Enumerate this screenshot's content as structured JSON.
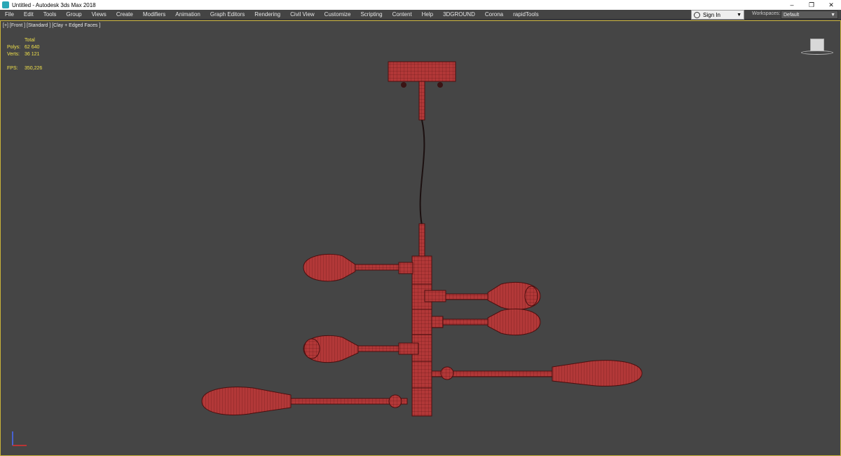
{
  "window": {
    "title": "Untitled - Autodesk 3ds Max 2018",
    "controls": {
      "minimize": "–",
      "restore": "❐",
      "close": "✕"
    }
  },
  "menu": {
    "items": [
      "File",
      "Edit",
      "Tools",
      "Group",
      "Views",
      "Create",
      "Modifiers",
      "Animation",
      "Graph Editors",
      "Rendering",
      "Civil View",
      "Customize",
      "Scripting",
      "Content",
      "Help",
      "3DGROUND",
      "Corona",
      "rapidTools"
    ],
    "sign_in": "Sign In",
    "workspaces_label": "Workspaces:",
    "workspace_value": "Default"
  },
  "viewport": {
    "label": "[+] [Front ] [Standard ] [Clay + Edged Faces ]",
    "stats": {
      "header": "Total",
      "polys_label": "Polys:",
      "polys_value": "62 640",
      "verts_label": "Verts:",
      "verts_value": "36 121",
      "fps_label": "FPS:",
      "fps_value": "350,226"
    }
  },
  "colors": {
    "model": "#b33a3a",
    "model_dark": "#5e1414",
    "viewport_border": "#c9b23a",
    "stats_text": "#f0e04a"
  },
  "icons": {
    "app": "3ds-max-icon",
    "user": "user-icon",
    "dropdown": "chevron-down-icon"
  }
}
